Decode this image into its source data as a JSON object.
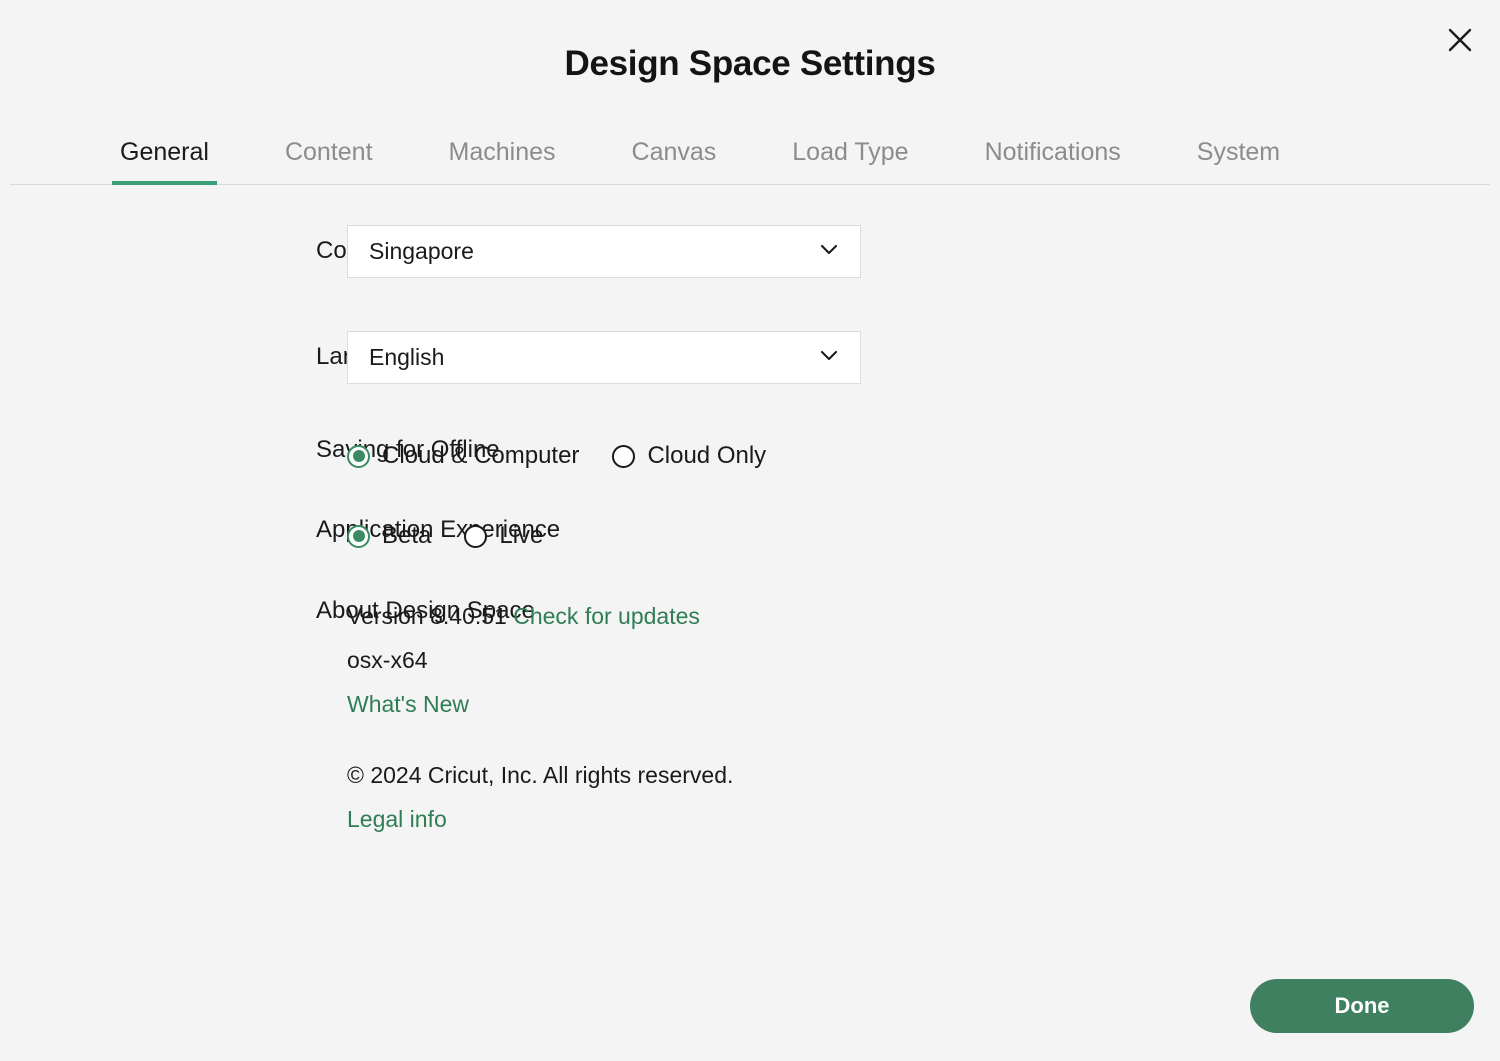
{
  "window": {
    "title": "Design Space Settings",
    "close_icon": "close-icon"
  },
  "tabs": [
    {
      "label": "General",
      "active": true
    },
    {
      "label": "Content",
      "active": false
    },
    {
      "label": "Machines",
      "active": false
    },
    {
      "label": "Canvas",
      "active": false
    },
    {
      "label": "Load Type",
      "active": false
    },
    {
      "label": "Notifications",
      "active": false
    },
    {
      "label": "System",
      "active": false
    }
  ],
  "settings": {
    "country": {
      "label": "Country",
      "info_icon": "info-icon",
      "value": "Singapore",
      "chevron_icon": "chevron-down-icon"
    },
    "language": {
      "label": "Language",
      "value": "English",
      "chevron_icon": "chevron-down-icon"
    },
    "saving_for_offline": {
      "label": "Saving for Offline",
      "options": [
        {
          "label": "Cloud & Computer",
          "selected": true
        },
        {
          "label": "Cloud Only",
          "selected": false
        }
      ]
    },
    "application_experience": {
      "label": "Application Experience",
      "options": [
        {
          "label": "Beta",
          "selected": true
        },
        {
          "label": "Live",
          "selected": false
        }
      ]
    },
    "about": {
      "label": "About Design Space",
      "version": "Version 8.40.51",
      "check_for_updates": "Check for updates",
      "platform": "osx-x64",
      "whats_new": "What's New",
      "copyright": "© 2024 Cricut, Inc. All rights reserved.",
      "legal_info": "Legal info"
    }
  },
  "footer": {
    "done_label": "Done"
  },
  "colors": {
    "accent_green": "#3a9e76",
    "link_green": "#2f7d55",
    "button_green": "#3f8060",
    "radio_green": "#3a8a63",
    "background": "#f4f4f4",
    "text": "#1a1a1a",
    "muted_text": "#8c8c8c"
  }
}
